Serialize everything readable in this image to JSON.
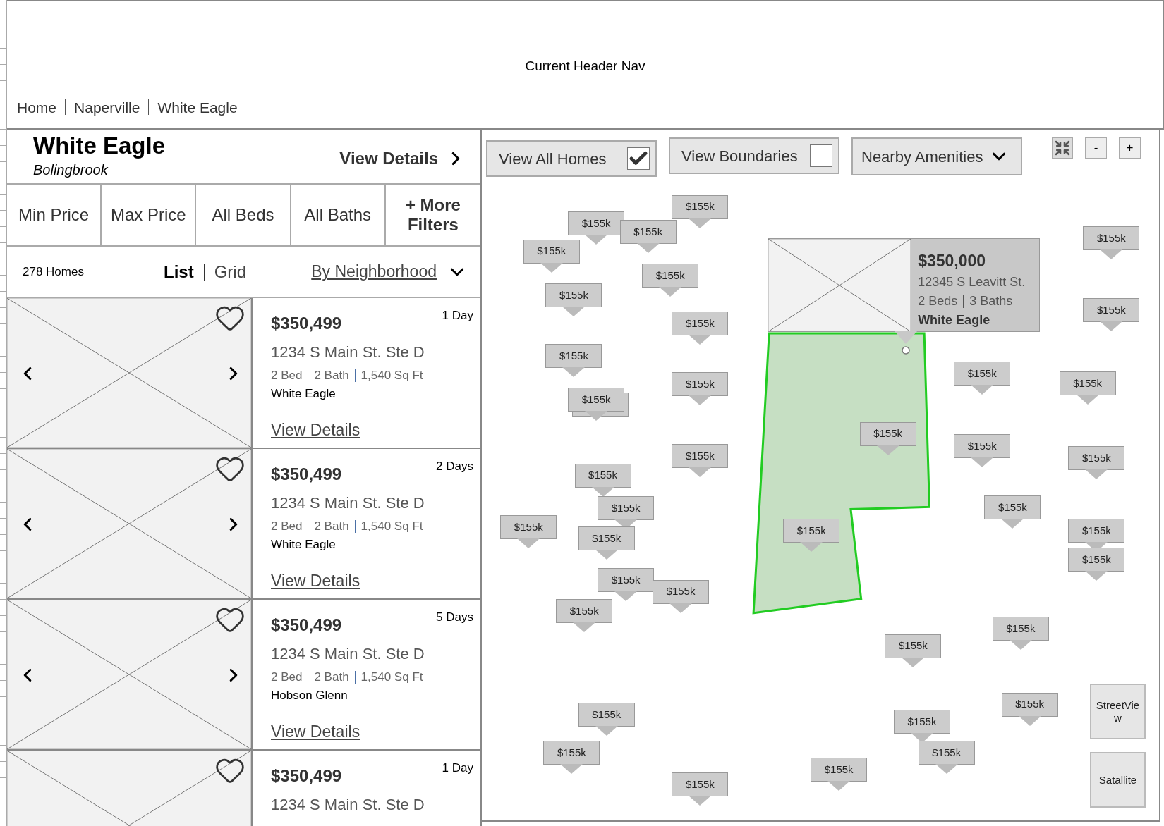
{
  "header": {
    "title": "Current Header Nav",
    "breadcrumbs": [
      "Home",
      "Naperville",
      "White Eagle"
    ]
  },
  "neighborhood": {
    "name": "White Eagle",
    "city": "Bolingbrook",
    "details_link": "View Details"
  },
  "filters": [
    {
      "label": "Min Price"
    },
    {
      "label": "Max Price"
    },
    {
      "label": "All Beds"
    },
    {
      "label": "All Baths"
    },
    {
      "label": "+ More Filters"
    }
  ],
  "results": {
    "count": "278 Homes",
    "views": [
      {
        "label": "List",
        "selected": true
      },
      {
        "label": "Grid",
        "selected": false
      }
    ],
    "sort": "By Neighborhood"
  },
  "listings": [
    {
      "price": "$350,499",
      "age": "1 Day",
      "address": "1234 S Main St. Ste D",
      "beds": "2 Bed",
      "baths": "2 Bath",
      "sqft": "1,540 Sq Ft",
      "neighborhood": "White Eagle",
      "link": "View Details"
    },
    {
      "price": "$350,499",
      "age": "2 Days",
      "address": "1234 S Main St. Ste D",
      "beds": "2 Bed",
      "baths": "2 Bath",
      "sqft": "1,540 Sq Ft",
      "neighborhood": "White Eagle",
      "link": "View Details"
    },
    {
      "price": "$350,499",
      "age": "5 Days",
      "address": "1234 S Main St. Ste D",
      "beds": "2 Bed",
      "baths": "2 Bath",
      "sqft": "1,540 Sq Ft",
      "neighborhood": "Hobson Glenn",
      "link": "View Details"
    },
    {
      "price": "$350,499",
      "age": "1 Day",
      "address": "1234 S Main St. Ste D"
    }
  ],
  "map": {
    "toggles": [
      {
        "kind": "checkbox",
        "label": "View All Homes",
        "checked": true
      },
      {
        "kind": "checkbox",
        "label": "View Boundaries",
        "checked": false
      },
      {
        "kind": "dropdown",
        "label": "Nearby Amenities"
      }
    ],
    "zoom_buttons": [
      "-",
      "+"
    ],
    "popup": {
      "price": "$350,000",
      "address": "12345 S Leavitt St.",
      "beds": "2 Beds",
      "baths": "3 Baths",
      "neighborhood": "White Eagle"
    },
    "pins": [
      "$155k",
      "$155k",
      "$155k",
      "$155k",
      "$155k",
      "$155k",
      "$155k",
      "$155k",
      "$155k",
      "$155k",
      "$155k",
      "$155k",
      "$155k",
      "$155k",
      "$155k",
      "$155k",
      "$155k",
      "$155k",
      "$155k",
      "$155k",
      "$155k",
      "$155k",
      "$155k",
      "$155k",
      "$155k",
      "$155k",
      "$155k",
      "$155k",
      "$155k",
      "$155k",
      "$155k",
      "$155k",
      "$155k",
      "$155k",
      "$155k",
      "$155k",
      "$155k",
      "$155k"
    ],
    "layer_buttons": [
      "StreetView",
      "Satallite"
    ]
  }
}
